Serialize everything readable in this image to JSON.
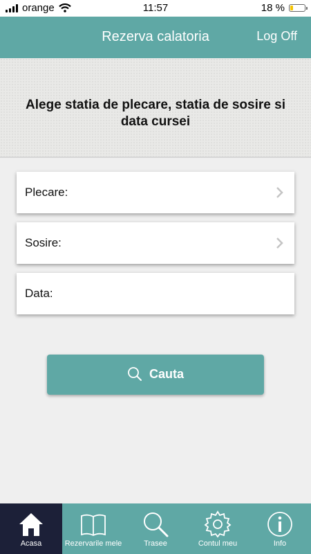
{
  "status": {
    "carrier": "orange",
    "time": "11:57",
    "battery": "18 %",
    "battery_level": 0.18
  },
  "header": {
    "title": "Rezerva calatoria",
    "logoff": "Log Off"
  },
  "banner": {
    "text": "Alege statia de plecare, statia de sosire si data cursei"
  },
  "form": {
    "departure_label": "Plecare:",
    "arrival_label": "Sosire:",
    "date_label": "Data:"
  },
  "search_button": {
    "label": "Cauta"
  },
  "tabs": [
    {
      "label": "Acasa",
      "icon": "home-icon"
    },
    {
      "label": "Rezervarile mele",
      "icon": "book-icon"
    },
    {
      "label": "Trasee",
      "icon": "search-icon"
    },
    {
      "label": "Contul meu",
      "icon": "gear-icon"
    },
    {
      "label": "Info",
      "icon": "info-icon"
    }
  ],
  "colors": {
    "primary": "#5fa8a5",
    "active_tab": "#1c2038"
  }
}
